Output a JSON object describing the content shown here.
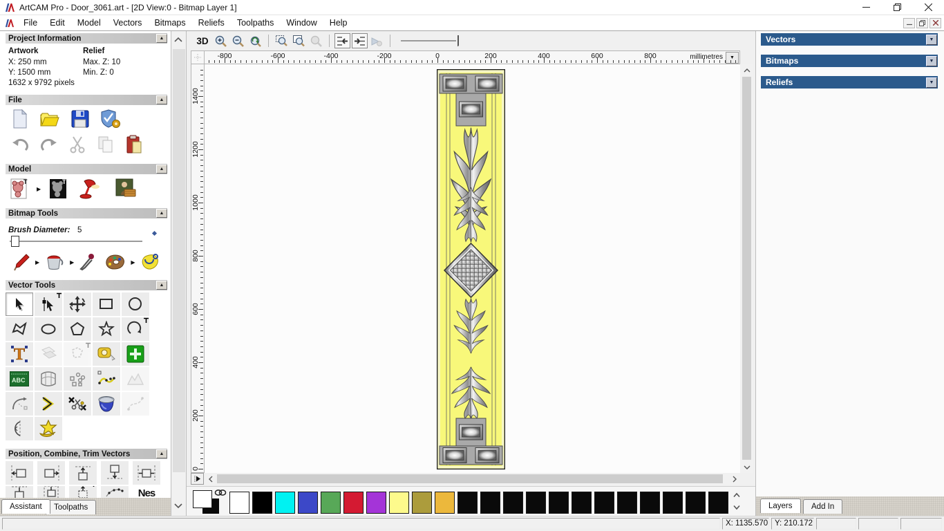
{
  "window": {
    "title": "ArtCAM Pro - Door_3061.art - [2D View:0 - Bitmap Layer 1]"
  },
  "menu": {
    "items": [
      "File",
      "Edit",
      "Model",
      "Vectors",
      "Bitmaps",
      "Reliefs",
      "Toolpaths",
      "Window",
      "Help"
    ]
  },
  "assistant": {
    "tabs": [
      "Assistant",
      "Toolpaths"
    ],
    "project_information": {
      "title": "Project Information",
      "artwork_label": "Artwork",
      "artwork_x": "X: 250 mm",
      "artwork_y": "Y: 1500 mm",
      "artwork_pixels": "1632 x 9792 pixels",
      "relief_label": "Relief",
      "relief_max_z": "Max. Z: 10",
      "relief_min_z": "Min. Z: 0"
    },
    "file_section": {
      "title": "File"
    },
    "model_section": {
      "title": "Model"
    },
    "bitmap_tools": {
      "title": "Bitmap Tools",
      "brush_diameter_label": "Brush Diameter:",
      "brush_diameter_value": "5"
    },
    "vector_tools": {
      "title": "Vector Tools"
    },
    "position_section": {
      "title": "Position, Combine, Trim Vectors",
      "nesting_label": "Nes"
    }
  },
  "canvas": {
    "toolbar": {
      "view_3d_label": "3D"
    },
    "ruler": {
      "unit_label": "millimetres",
      "h_labels": [
        "-800",
        "-600",
        "-400",
        "-200",
        "0",
        "200",
        "400",
        "600",
        "800"
      ],
      "v_labels": [
        "1400",
        "1200",
        "1000",
        "800",
        "600",
        "400",
        "200",
        "0"
      ]
    }
  },
  "right_panel": {
    "sections": [
      "Vectors",
      "Bitmaps",
      "Reliefs"
    ],
    "tabs": [
      "Layers",
      "Add In"
    ]
  },
  "palette": {
    "swatches": [
      "#ffffff",
      "#000000",
      "#00f2f2",
      "#3c48c8",
      "#58a858",
      "#d41a32",
      "#a434d8",
      "#fdfa8c",
      "#ac9c3c",
      "#ecb83c",
      "#0a0a0a",
      "#0a0a0a",
      "#0a0a0a",
      "#0a0a0a",
      "#0a0a0a",
      "#0a0a0a",
      "#0a0a0a",
      "#0a0a0a",
      "#0a0a0a",
      "#0a0a0a",
      "#0a0a0a",
      "#0a0a0a"
    ]
  },
  "status_bar": {
    "x_coord": "X: 1135.570",
    "y_coord": "Y: 210.172"
  },
  "colors": {
    "panel_header_blue": "#2b5a8c",
    "door_yellow": "#f8f87a",
    "paste_green": "#18a018",
    "ornament_grey": "#9a9a9a"
  }
}
